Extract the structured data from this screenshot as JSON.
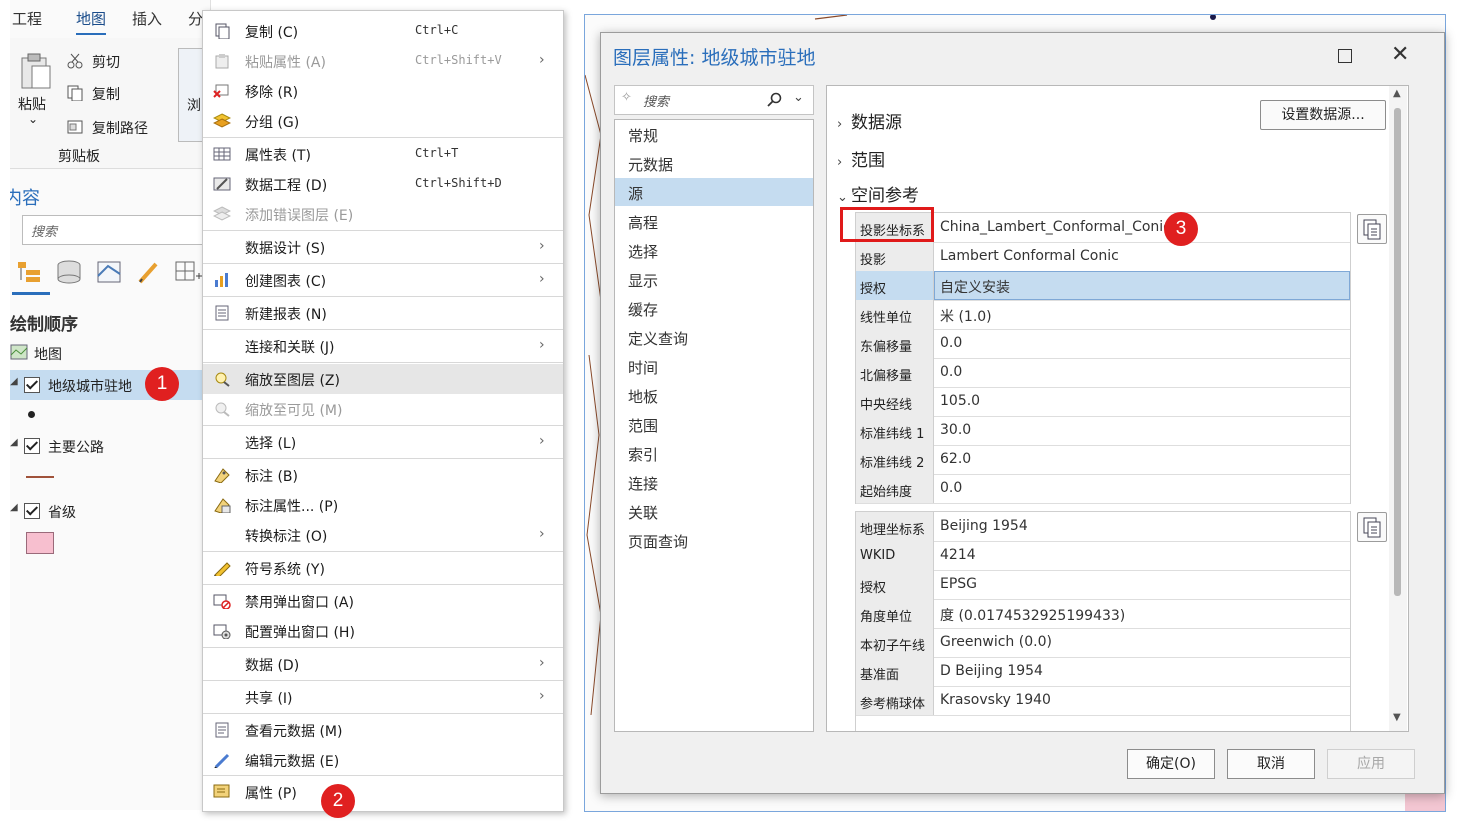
{
  "ribbon": {
    "tabs": [
      "工程",
      "地图",
      "插入",
      "分"
    ],
    "paste_label": "粘贴",
    "cut_label": "剪切",
    "copy_label": "复制",
    "copy_path_label": "复制路径",
    "clipboard_group": "剪贴板",
    "browse_label": "浏"
  },
  "contents": {
    "header": "内容",
    "search_placeholder": "搜索",
    "draw_order": "绘制顺序",
    "map_label": "地图",
    "layers": [
      {
        "name": "地级城市驻地",
        "checked": true
      },
      {
        "name": "主要公路",
        "checked": true
      },
      {
        "name": "省级",
        "checked": true
      }
    ],
    "polygon_color": "#f7bfcf"
  },
  "menu": {
    "items": [
      {
        "label": "复制 (C)",
        "shortcut": "Ctrl+C",
        "disabled": false,
        "submenu": false
      },
      {
        "label": "粘贴属性 (A)",
        "shortcut": "Ctrl+Shift+V",
        "disabled": true,
        "submenu": true
      },
      {
        "label": "移除 (R)",
        "shortcut": "",
        "disabled": false,
        "submenu": false
      },
      {
        "label": "分组 (G)",
        "shortcut": "",
        "disabled": false,
        "submenu": false
      },
      {
        "label": "属性表 (T)",
        "shortcut": "Ctrl+T",
        "disabled": false,
        "submenu": false
      },
      {
        "label": "数据工程 (D)",
        "shortcut": "Ctrl+Shift+D",
        "disabled": false,
        "submenu": false
      },
      {
        "label": "添加错误图层 (E)",
        "shortcut": "",
        "disabled": true,
        "submenu": false
      },
      {
        "label": "数据设计 (S)",
        "shortcut": "",
        "disabled": false,
        "submenu": true
      },
      {
        "label": "创建图表 (C)",
        "shortcut": "",
        "disabled": false,
        "submenu": true
      },
      {
        "label": "新建报表 (N)",
        "shortcut": "",
        "disabled": false,
        "submenu": false
      },
      {
        "label": "连接和关联 (J)",
        "shortcut": "",
        "disabled": false,
        "submenu": true
      },
      {
        "label": "缩放至图层 (Z)",
        "shortcut": "",
        "disabled": false,
        "submenu": false
      },
      {
        "label": "缩放至可见 (M)",
        "shortcut": "",
        "disabled": true,
        "submenu": false
      },
      {
        "label": "选择 (L)",
        "shortcut": "",
        "disabled": false,
        "submenu": true
      },
      {
        "label": "标注 (B)",
        "shortcut": "",
        "disabled": false,
        "submenu": false
      },
      {
        "label": "标注属性... (P)",
        "shortcut": "",
        "disabled": false,
        "submenu": false
      },
      {
        "label": "转换标注 (O)",
        "shortcut": "",
        "disabled": false,
        "submenu": true
      },
      {
        "label": "符号系统 (Y)",
        "shortcut": "",
        "disabled": false,
        "submenu": false
      },
      {
        "label": "禁用弹出窗口 (A)",
        "shortcut": "",
        "disabled": false,
        "submenu": false
      },
      {
        "label": "配置弹出窗口 (H)",
        "shortcut": "",
        "disabled": false,
        "submenu": false
      },
      {
        "label": "数据 (D)",
        "shortcut": "",
        "disabled": false,
        "submenu": true
      },
      {
        "label": "共享 (I)",
        "shortcut": "",
        "disabled": false,
        "submenu": true
      },
      {
        "label": "查看元数据 (M)",
        "shortcut": "",
        "disabled": false,
        "submenu": false
      },
      {
        "label": "编辑元数据 (E)",
        "shortcut": "",
        "disabled": false,
        "submenu": false
      },
      {
        "label": "属性 (P)",
        "shortcut": "",
        "disabled": false,
        "submenu": false
      }
    ]
  },
  "badges": {
    "one": "1",
    "two": "2",
    "three": "3"
  },
  "dialog": {
    "title": "图层属性: 地级城市驻地",
    "search_placeholder": "搜索",
    "nav": [
      "常规",
      "元数据",
      "源",
      "高程",
      "选择",
      "显示",
      "缓存",
      "定义查询",
      "时间",
      "地板",
      "范围",
      "索引",
      "连接",
      "关联",
      "页面查询"
    ],
    "selected_nav": "源",
    "set_source_button": "设置数据源...",
    "sections": {
      "data_source": "数据源",
      "extent": "范围",
      "spatial_ref": "空间参考"
    },
    "projected": [
      {
        "key": "投影坐标系",
        "value": "China_Lambert_Conformal_Conic"
      },
      {
        "key": "投影",
        "value": "Lambert Conformal Conic"
      },
      {
        "key": "授权",
        "value": "自定义安装"
      },
      {
        "key": "线性单位",
        "value": "米 (1.0)"
      },
      {
        "key": "东偏移量",
        "value": "0.0"
      },
      {
        "key": "北偏移量",
        "value": "0.0"
      },
      {
        "key": "中央经线",
        "value": "105.0"
      },
      {
        "key": "标准纬线 1",
        "value": "30.0"
      },
      {
        "key": "标准纬线 2",
        "value": "62.0"
      },
      {
        "key": "起始纬度",
        "value": "0.0"
      }
    ],
    "geographic": [
      {
        "key": "地理坐标系",
        "value": "Beijing 1954"
      },
      {
        "key": "WKID",
        "value": "4214"
      },
      {
        "key": "授权",
        "value": "EPSG"
      },
      {
        "key": "角度单位",
        "value": "度 (0.0174532925199433)"
      },
      {
        "key": "本初子午线",
        "value": "Greenwich (0.0)"
      },
      {
        "key": "基准面",
        "value": "D Beijing 1954"
      },
      {
        "key": "参考椭球体",
        "value": "Krasovsky 1940"
      }
    ],
    "ok_button": "确定(O)",
    "cancel_button": "取消",
    "apply_button": "应用"
  },
  "colors": {
    "accent": "#2a6ebb",
    "selection": "#c5dcf0",
    "badge": "#e02020",
    "highlight_box": "#e01a1a"
  }
}
